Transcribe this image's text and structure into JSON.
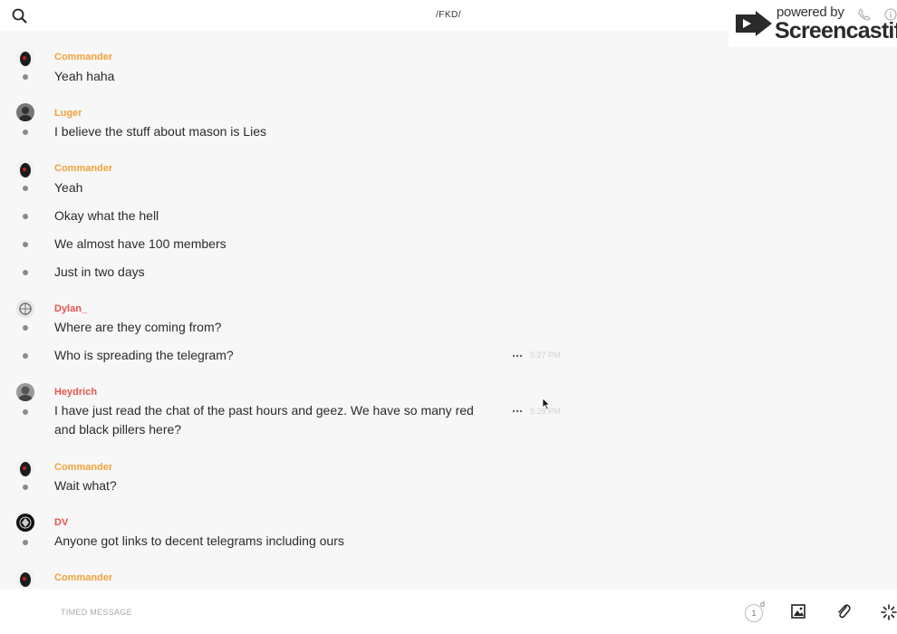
{
  "channel": {
    "title": "/FKD/"
  },
  "watermark": {
    "powered": "powered by",
    "brand": "Screencastify"
  },
  "colors": {
    "orange": "#f0a23a",
    "red": "#e8544e",
    "dot": "#8a8a8a"
  },
  "messages": [
    {
      "user": "Commander",
      "text": "Yeah haha"
    },
    {
      "user": "Luger",
      "text": "I believe the stuff about mason is Lies"
    },
    {
      "user": "Commander",
      "text": "Yeah"
    },
    {
      "text": "Okay what the hell"
    },
    {
      "text": "We almost have 100 members"
    },
    {
      "text": "Just in two days"
    },
    {
      "user": "Dylan_",
      "text": "Where are they coming from?"
    },
    {
      "text": "Who is spreading the telegram?",
      "time": "5:27 PM"
    },
    {
      "user": "Heydrich",
      "text": "I have just read the chat of the past hours and geez. We have so many red and black pillers here?",
      "time": "5:28 PM"
    },
    {
      "user": "Commander",
      "text": "Wait what?"
    },
    {
      "user": "DV",
      "text": "Anyone got links to decent telegrams including ours"
    },
    {
      "user": "Commander"
    }
  ],
  "composer": {
    "placeholder": "TIMED MESSAGE",
    "timer_value": "1",
    "timer_unit": "d"
  }
}
